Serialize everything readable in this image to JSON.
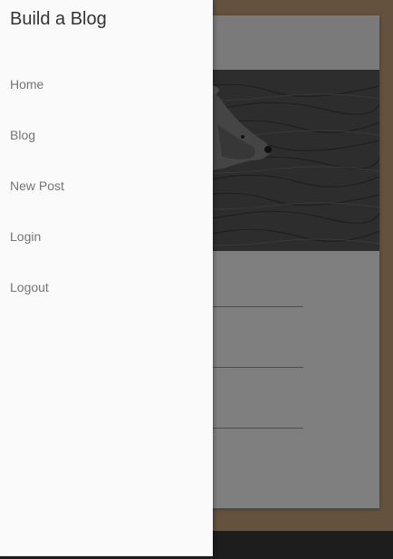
{
  "app": {
    "title": "Build a Blog"
  },
  "drawer": {
    "nav_items": [
      {
        "label": "Home"
      },
      {
        "label": "Blog"
      },
      {
        "label": "New Post"
      },
      {
        "label": "Login"
      },
      {
        "label": "Logout"
      }
    ]
  },
  "background_page": {
    "card_image": "bear-in-water-photo"
  },
  "colors": {
    "page_background": "#c8a57c",
    "drawer_background": "#fafafa",
    "footer": "#3a3a3a",
    "scrim": "rgba(0,0,0,0.5)"
  }
}
